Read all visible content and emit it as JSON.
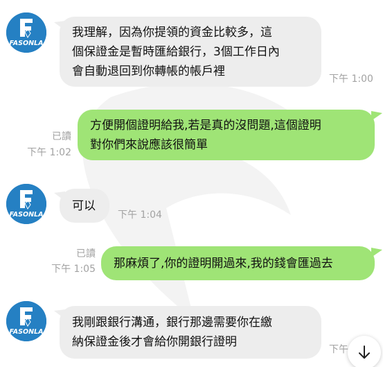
{
  "sender": {
    "logo_text": "FASONLA",
    "logo_color": "#2580c3"
  },
  "messages": [
    {
      "dir": "in",
      "lines": [
        "我理解，因為你提領的資金比較多，這",
        "個保證金是暫時匯給銀行，3個工作日內",
        "會自動退回到你轉帳的帳戶裡"
      ],
      "time": "下午 1:00"
    },
    {
      "dir": "out",
      "lines": [
        "方便開個證明給我,若是真的沒問題,這個證明",
        "對你們來說應該很簡單"
      ],
      "read": "已讀",
      "time": "下午 1:02"
    },
    {
      "dir": "in",
      "lines": [
        "可以"
      ],
      "time": "下午 1:04"
    },
    {
      "dir": "out",
      "lines": [
        "那麻煩了,你的證明開過來,我的錢會匯過去"
      ],
      "read": "已讀",
      "time": "下午 1:05"
    },
    {
      "dir": "in",
      "lines": [
        "我剛跟銀行溝通，銀行那邊需要你在繳",
        "納保證金後才會給你開銀行證明"
      ],
      "time": "下午"
    }
  ],
  "colors": {
    "incoming": "#ededed",
    "outgoing": "#9fe476",
    "meta": "#a2a2a2"
  }
}
